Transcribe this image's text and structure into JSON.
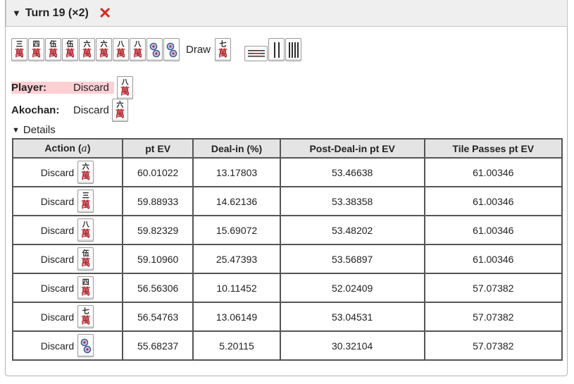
{
  "header": {
    "toggle_glyph": "▼",
    "title": "Turn 19 (×2)",
    "close_glyph": "✕",
    "close_color": "#d8281e"
  },
  "hand": {
    "tiles": [
      {
        "num": "三",
        "suit": "萬"
      },
      {
        "num": "四",
        "suit": "萬"
      },
      {
        "num": "伍",
        "suit": "萬"
      },
      {
        "num": "伍",
        "suit": "萬"
      },
      {
        "num": "六",
        "suit": "萬"
      },
      {
        "num": "六",
        "suit": "萬"
      },
      {
        "num": "八",
        "suit": "萬"
      },
      {
        "num": "八",
        "suit": "萬"
      },
      {
        "num": "2p",
        "suit": "pin"
      },
      {
        "num": "2p",
        "suit": "pin"
      }
    ],
    "draw_label": "Draw",
    "draw_tile": {
      "num": "七",
      "suit": "萬"
    },
    "meld": [
      "side-sou",
      "sou-tile",
      "sou-tile"
    ]
  },
  "player": {
    "name": "Player:",
    "action": "Discard",
    "tile": {
      "num": "八",
      "suit": "萬"
    },
    "highlight": "#fcd0d3"
  },
  "akochan": {
    "name": "Akochan:",
    "action": "Discard",
    "tile": {
      "num": "六",
      "suit": "萬"
    }
  },
  "details": {
    "toggle_glyph": "▼",
    "label": "Details"
  },
  "table": {
    "headers": [
      "Action (",
      "a",
      ")",
      "pt EV",
      "Deal-in (%)",
      "Post-Deal-in pt EV",
      "Tile Passes pt EV"
    ],
    "rows": [
      {
        "action": "Discard",
        "tile": {
          "num": "六",
          "suit": "萬"
        },
        "pt_ev": "60.01022",
        "deal_in": "13.17803",
        "post": "53.46638",
        "passes": "61.00346"
      },
      {
        "action": "Discard",
        "tile": {
          "num": "三",
          "suit": "萬"
        },
        "pt_ev": "59.88933",
        "deal_in": "14.62136",
        "post": "53.38358",
        "passes": "61.00346"
      },
      {
        "action": "Discard",
        "tile": {
          "num": "八",
          "suit": "萬"
        },
        "pt_ev": "59.82329",
        "deal_in": "15.69072",
        "post": "53.48202",
        "passes": "61.00346"
      },
      {
        "action": "Discard",
        "tile": {
          "num": "伍",
          "suit": "萬"
        },
        "pt_ev": "59.10960",
        "deal_in": "25.47393",
        "post": "53.56897",
        "passes": "61.00346"
      },
      {
        "action": "Discard",
        "tile": {
          "num": "四",
          "suit": "萬"
        },
        "pt_ev": "56.56306",
        "deal_in": "10.11452",
        "post": "52.02409",
        "passes": "57.07382"
      },
      {
        "action": "Discard",
        "tile": {
          "num": "七",
          "suit": "萬"
        },
        "pt_ev": "56.54763",
        "deal_in": "13.06149",
        "post": "53.04531",
        "passes": "57.07382"
      },
      {
        "action": "Discard",
        "tile": {
          "num": "2p",
          "suit": "pin"
        },
        "pt_ev": "55.68237",
        "deal_in": "5.20115",
        "post": "30.32104",
        "passes": "57.07382"
      }
    ]
  }
}
